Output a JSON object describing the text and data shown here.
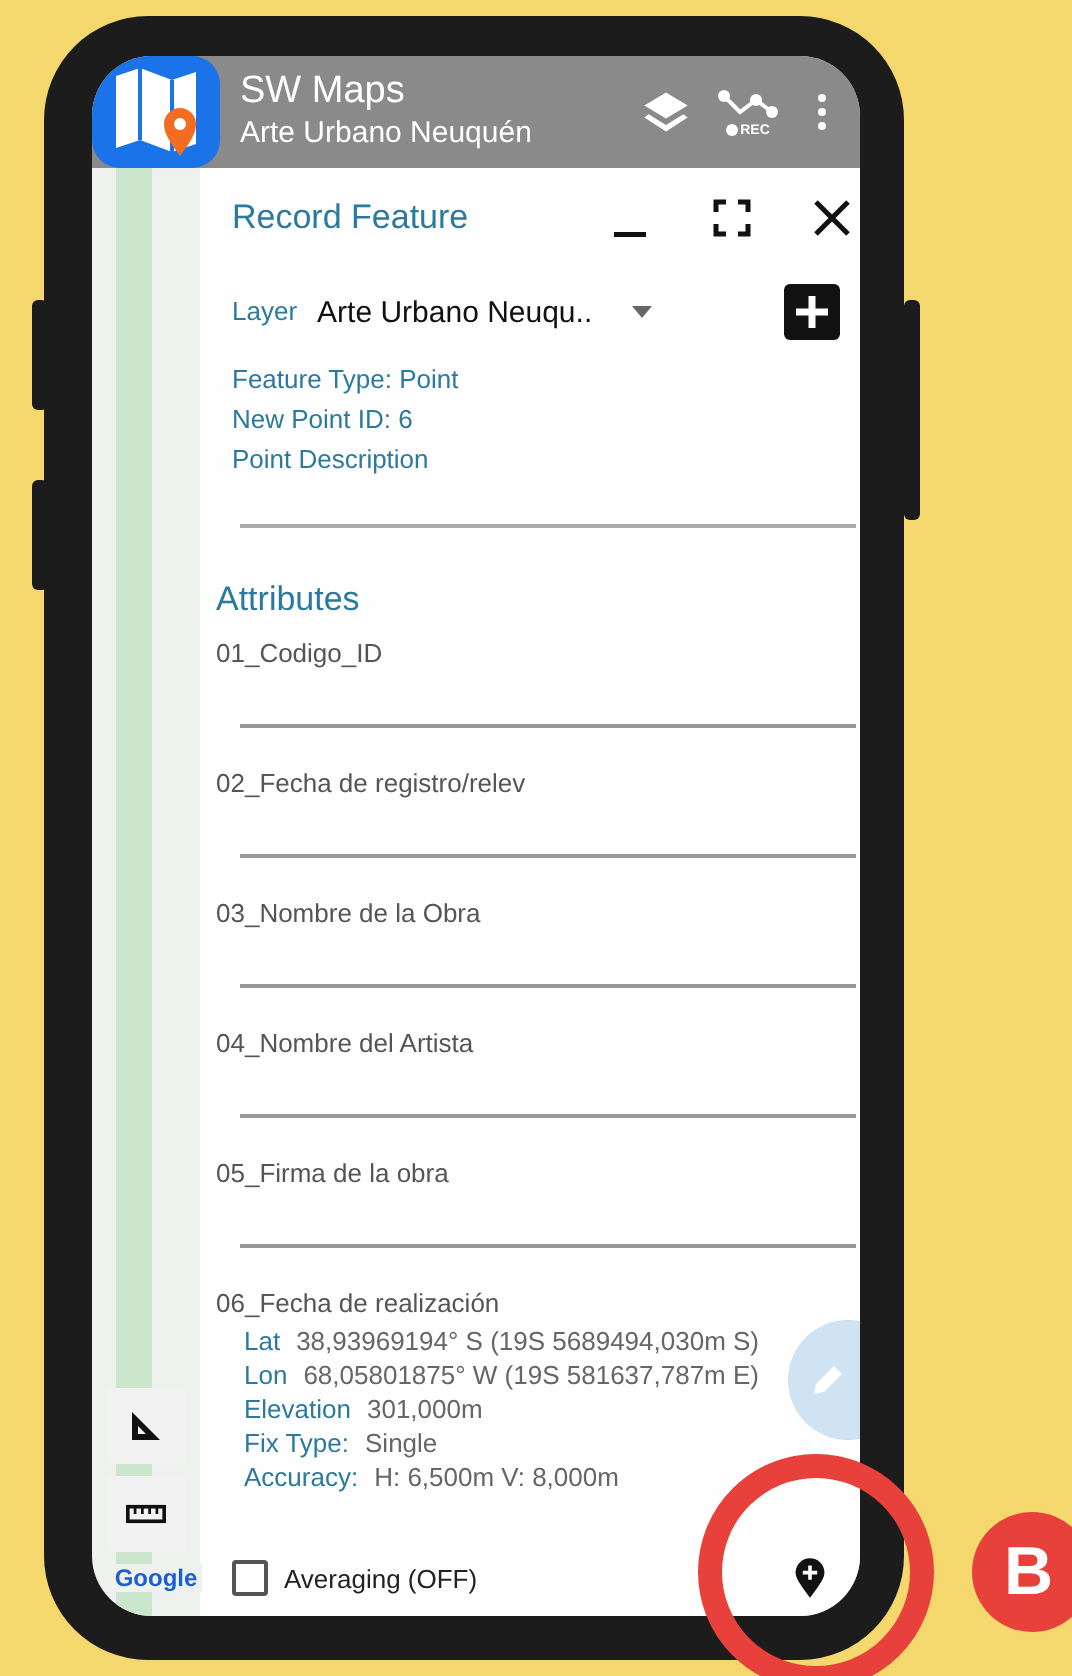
{
  "app_bar": {
    "title": "SW Maps",
    "subtitle": "Arte Urbano Neuquén",
    "rec_label": "REC"
  },
  "record_panel": {
    "title": "Record Feature",
    "layer_label": "Layer",
    "layer_value": "Arte Urbano Neuqu..",
    "info": [
      "Feature Type: Point",
      "New Point ID: 6",
      "Point Description"
    ],
    "attributes_title": "Attributes",
    "attributes": [
      {
        "label": "01_Codigo_ID"
      },
      {
        "label": "02_Fecha de registro/relev"
      },
      {
        "label": "03_Nombre de la Obra"
      },
      {
        "label": "04_Nombre del Artista"
      },
      {
        "label": "05_Firma de la obra"
      },
      {
        "label": "06_Fecha de realización"
      }
    ]
  },
  "gps": [
    {
      "label": "Lat",
      "value": "38,93969194° S (19S 5689494,030m S)"
    },
    {
      "label": "Lon",
      "value": "68,05801875° W (19S 581637,787m E)"
    },
    {
      "label": "Elevation",
      "value": "301,000m"
    },
    {
      "label": "Fix Type:",
      "value": "Single"
    },
    {
      "label": "Accuracy:",
      "value": "H: 6,500m V: 8,000m"
    }
  ],
  "averaging": {
    "label": "Averaging (OFF)",
    "checked": false
  },
  "map": {
    "attribution": "Google"
  },
  "annotation": {
    "badge": "B"
  }
}
